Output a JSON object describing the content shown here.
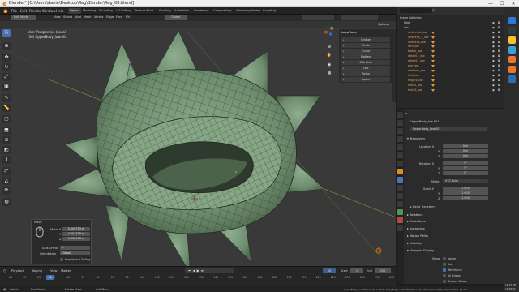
{
  "window": {
    "title": "Blender* [C:\\Users\\danie\\Desktop\\Reg\\Blender\\Reg_08.blend]",
    "minimize": "—",
    "maximize": "☐",
    "close": "✕"
  },
  "menubar": {
    "items": [
      "File",
      "Edit",
      "Render",
      "Window",
      "Help"
    ],
    "workspaces": [
      "Layout",
      "Modeling",
      "Sculpting",
      "UV Editing",
      "Texture Paint",
      "Shading",
      "Animation",
      "Rendering",
      "Compositing",
      "Geometry Nodes",
      "Scripting"
    ],
    "active_workspace": "Layout",
    "scene": "Scene",
    "view_layer": "View Layer"
  },
  "viewport_header": {
    "mode": "Edit Mode",
    "menus": [
      "View",
      "Select",
      "Add",
      "Mesh",
      "Vertex",
      "Edge",
      "Face",
      "UV"
    ],
    "orientation": "Global",
    "options_label": "Options"
  },
  "viewport": {
    "perspective_label": "User Perspective (Local)",
    "object_label": "(36) UpperBody_low.001",
    "colors": {
      "background": "#393939",
      "mesh_fill": "#7e9b7e",
      "mesh_edge": "#1e2a1e",
      "axis_red": "#8e3d3d",
      "axis_green": "#7f9a3c"
    }
  },
  "looptools": {
    "header": "LoopTools",
    "items": [
      "Bridge",
      "Circle",
      "Curve",
      "Flatten",
      "Gstretch",
      "Loft",
      "Relax",
      "Space"
    ]
  },
  "move_panel": {
    "title": "Move",
    "move_label": "Move X",
    "y_label": "Y",
    "z_label": "Z",
    "move_x": "0.000753 m",
    "move_y": "0.001378 m",
    "move_z": "0.002473 m",
    "axis_ortho_label": "Axis Ortho",
    "axis_ortho": "X",
    "orientation_label": "Orientation",
    "orientation": "Global",
    "proportional_label": "Proportional Editing"
  },
  "outliner": {
    "search_placeholder": "",
    "rows": [
      {
        "name": "Scene Collection",
        "indent": 0,
        "type": "root"
      },
      {
        "name": "Hide",
        "indent": 1,
        "type": "collection"
      },
      {
        "name": "low",
        "indent": 1,
        "type": "collection"
      },
      {
        "name": "umbrellas_low",
        "indent": 2,
        "type": "mesh"
      },
      {
        "name": "umbrella_5_low",
        "indent": 2,
        "type": "mesh"
      },
      {
        "name": "umbrella_low",
        "indent": 2,
        "type": "mesh"
      },
      {
        "name": "arm_low",
        "indent": 2,
        "type": "mesh"
      },
      {
        "name": "badge_low",
        "indent": 2,
        "type": "mesh"
      },
      {
        "name": "detail01_low",
        "indent": 2,
        "type": "mesh"
      },
      {
        "name": "detail02_low",
        "indent": 2,
        "type": "mesh"
      },
      {
        "name": "eye_low",
        "indent": 2,
        "type": "mesh"
      },
      {
        "name": "eyebrow_low",
        "indent": 2,
        "type": "mesh"
      },
      {
        "name": "feet_low",
        "indent": 2,
        "type": "mesh"
      },
      {
        "name": "fingers_low",
        "indent": 2,
        "type": "mesh"
      },
      {
        "name": "hair01_low",
        "indent": 2,
        "type": "mesh"
      },
      {
        "name": "hair02_low",
        "indent": 2,
        "type": "mesh"
      }
    ]
  },
  "properties": {
    "object_name": "UpperBody_low.001",
    "object_field": "UpperBody_low.001",
    "transform_header": "Transform",
    "location_label": "Location X",
    "rotation_label": "Rotation X",
    "scale_label": "Scale X",
    "y_label": "Y",
    "z_label": "Z",
    "location": [
      "0 m",
      "0 m",
      "0 m"
    ],
    "rotation": [
      "0°",
      "0°",
      "0°"
    ],
    "mode_label": "Mode",
    "mode": "XYZ Euler",
    "scale": [
      "1.000",
      "1.000",
      "1.000"
    ],
    "sections": [
      "Delta Transform",
      "Relations",
      "Collections",
      "Instancing",
      "Motion Paths",
      "Visibility",
      "Viewport Display"
    ],
    "viewport_display": {
      "show_label": "Show",
      "options": [
        "Name",
        "Axis",
        "Wireframe",
        "All Edges",
        "Texture Space"
      ],
      "checked": [
        false,
        false,
        true,
        false,
        false
      ]
    }
  },
  "timeline": {
    "menus": [
      "Playback",
      "Keying",
      "View",
      "Marker"
    ],
    "current_frame": "36",
    "start_label": "Start",
    "start": "1",
    "end_label": "End",
    "end": "250",
    "ticks": [
      "-10",
      "10",
      "20",
      "30",
      "40",
      "50",
      "60",
      "70",
      "80",
      "90",
      "100",
      "110",
      "120",
      "130",
      "140",
      "150",
      "160",
      "170",
      "180",
      "190",
      "200",
      "210",
      "220",
      "230",
      "240",
      "250",
      "260"
    ]
  },
  "statusbar": {
    "left": [
      "Select",
      "Box Select",
      "Rotate View",
      "Call Menu"
    ],
    "right": "UpperBody_low.001 | Verts 1,003/1,470 | Edges 0/2,939 | Faces 0/1,470 | Tris 2,936 | Objects 0/21 | 3.1.0",
    "clock_time": "12:13 PM",
    "clock_date": "12/18/22"
  }
}
